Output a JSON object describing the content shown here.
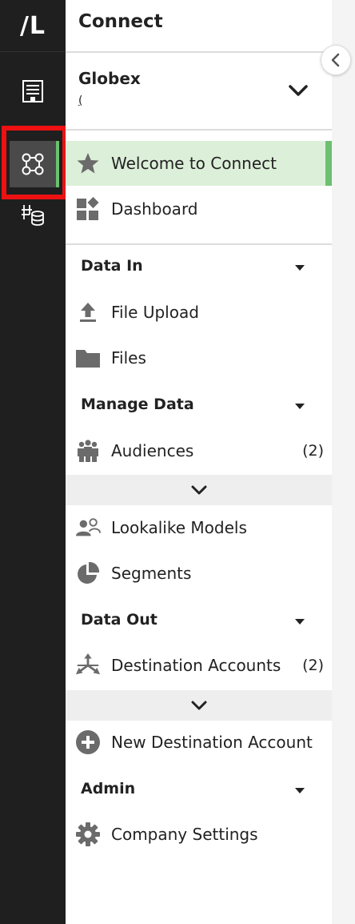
{
  "rail": {
    "logo": "/L",
    "items": [
      {
        "icon": "building-icon"
      },
      {
        "icon": "connections-icon"
      },
      {
        "icon": "data-warehouse-icon"
      }
    ]
  },
  "panel": {
    "title": "Connect",
    "org": {
      "name": "Globex",
      "sub": "("
    },
    "nav": {
      "welcome": {
        "label": "Welcome to Connect",
        "icon": "star-icon"
      },
      "dashboard": {
        "label": "Dashboard",
        "icon": "dashboard-icon"
      }
    },
    "sections": {
      "data_in": {
        "title": "Data In",
        "items": {
          "file_upload": {
            "label": "File Upload",
            "icon": "upload-icon"
          },
          "files": {
            "label": "Files",
            "icon": "folder-icon"
          }
        }
      },
      "manage_data": {
        "title": "Manage Data",
        "items": {
          "audiences": {
            "label": "Audiences",
            "count": "(2)",
            "icon": "people-icon"
          },
          "lookalike": {
            "label": "Lookalike Models",
            "icon": "lookalike-icon"
          },
          "segments": {
            "label": "Segments",
            "icon": "pie-icon"
          }
        }
      },
      "data_out": {
        "title": "Data Out",
        "items": {
          "destinations": {
            "label": "Destination Accounts",
            "count": "(2)",
            "icon": "arrows-out-icon"
          },
          "new_destination": {
            "label": "New Destination Account",
            "icon": "plus-circle-icon"
          }
        }
      },
      "admin": {
        "title": "Admin",
        "items": {
          "company_settings": {
            "label": "Company Settings",
            "icon": "gear-icon"
          }
        }
      }
    }
  },
  "colors": {
    "rail_bg": "#1f1f1f",
    "active_bg": "#dcefd8",
    "accent": "#6cc070",
    "highlight": "#ee1111",
    "icon_gray": "#6b6b6b"
  }
}
